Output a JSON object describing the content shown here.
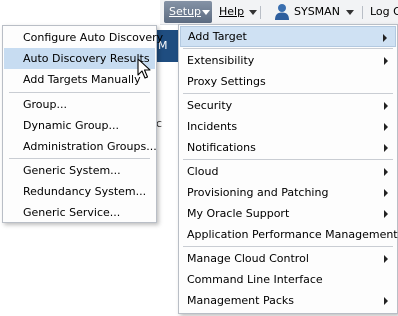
{
  "topbar": {
    "setup_label": "Setup",
    "help_label": "Help",
    "user_label": "SYSMAN",
    "logout_label": "Log O"
  },
  "background": {
    "header_fragment": "M",
    "text_fragment": "c"
  },
  "add_target_menu": {
    "items": [
      "Configure Auto Discovery",
      "Auto Discovery Results",
      "Add Targets Manually",
      "Group...",
      "Dynamic Group...",
      "Administration Groups...",
      "Generic System...",
      "Redundancy System...",
      "Generic Service..."
    ],
    "highlighted": "Auto Discovery Results"
  },
  "setup_menu": {
    "items": [
      "Add Target",
      "Extensibility",
      "Proxy Settings",
      "Security",
      "Incidents",
      "Notifications",
      "Cloud",
      "Provisioning and Patching",
      "My Oracle Support",
      "Application Performance Management",
      "Manage Cloud Control",
      "Command Line Interface",
      "Management Packs"
    ],
    "highlighted": "Add Target"
  }
}
